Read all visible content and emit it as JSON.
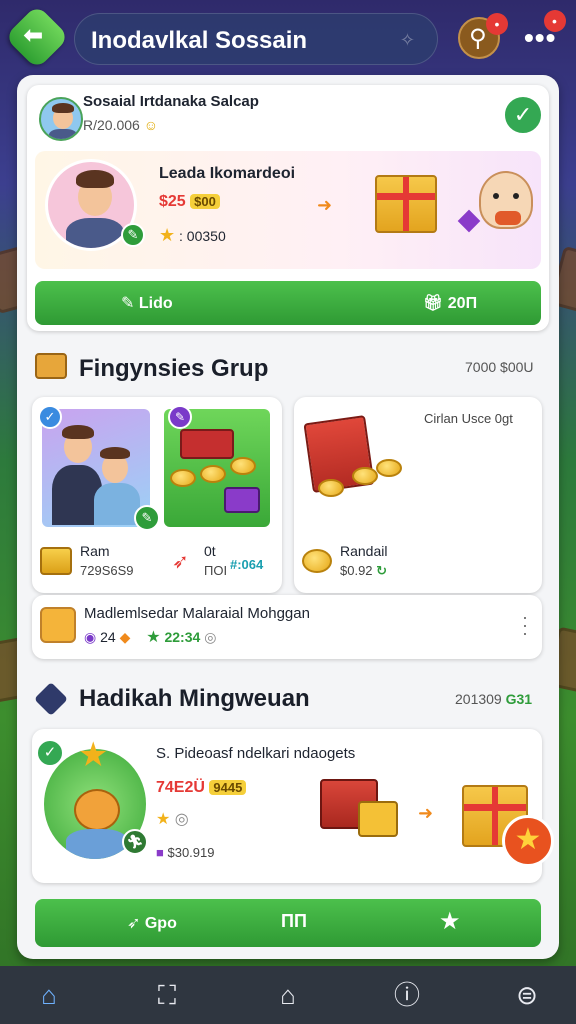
{
  "topbar": {
    "title": "Inodavlkal Sossain",
    "back_icon": "arrow-left-icon",
    "search_badge": "•",
    "more_label": "•••",
    "more_badge": "•"
  },
  "profile_card": {
    "name": "Sosaial Irtdanaka Salcap",
    "id_text": "R/20.006",
    "featured_name": "Leada Ikomardeoi",
    "price_red": "$25",
    "price_tag": "$00",
    "star_value": ": 00350",
    "btn_left": "Lido",
    "btn_right": "20П"
  },
  "group_section": {
    "title": "Fingynsies Grup",
    "meta": "7000 $00U",
    "right_card_title": "Cirlan Usce 0gt",
    "item1_name": "Ram",
    "item1_value": "729S6S9",
    "item2_name": "0t",
    "item2_sub": "ПОІ",
    "item2_value": "#:064",
    "item3_name": "Randail",
    "item3_value": "$0.92",
    "row_title": "Madlemlsedar Malaraial Mohggan",
    "row_val1": "24",
    "row_val2": "22:34"
  },
  "weekly_section": {
    "title": "Hadikah Mingweuan",
    "meta_num": "201309",
    "meta_green": "G31",
    "card_title": "S. Pideoasf ndelkari ndaogets",
    "price_red": "74E2Ü",
    "price_tag": "9445",
    "value": "$30.919",
    "btn_left": "Gpo",
    "btn_mid": "ПП",
    "btn_right": "★"
  },
  "nav": [
    "home-icon",
    "bookmark-icon",
    "house-icon",
    "info-icon",
    "settings-icon"
  ],
  "colors": {
    "accent_green": "#2f9a34",
    "danger_red": "#e53935",
    "panel_bg": "#f4f5f7"
  }
}
